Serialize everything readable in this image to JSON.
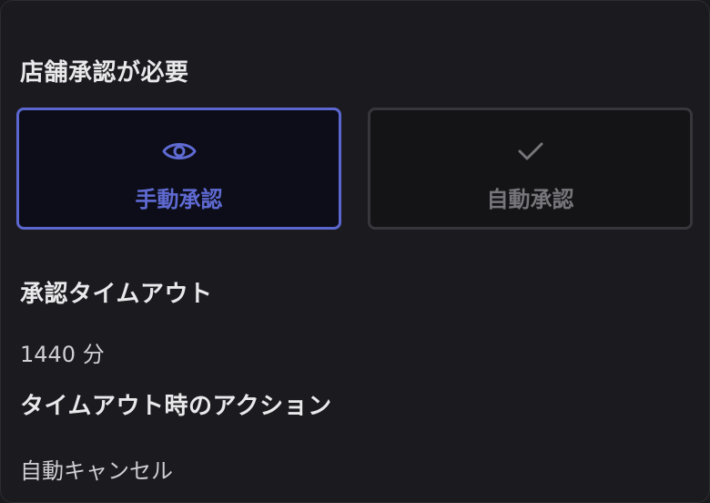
{
  "store_approval": {
    "title": "店舗承認が必要",
    "options": [
      {
        "label": "手動承認",
        "icon": "eye-icon",
        "selected": true
      },
      {
        "label": "自動承認",
        "icon": "check-icon",
        "selected": false
      }
    ]
  },
  "timeout": {
    "title": "承認タイムアウト",
    "value": "1440 分"
  },
  "timeout_action": {
    "title": "タイムアウト時のアクション",
    "value": "自動キャンセル"
  },
  "colors": {
    "accent": "#5f6ad2",
    "background": "#1b1b1f",
    "muted": "#75757a"
  }
}
